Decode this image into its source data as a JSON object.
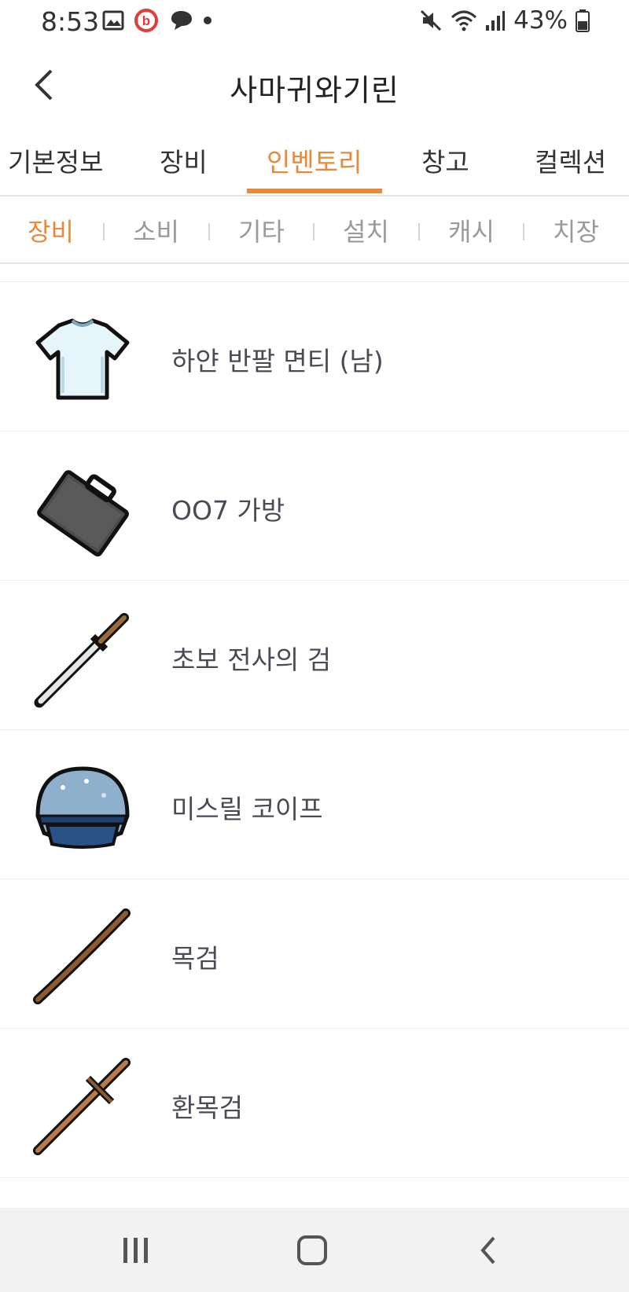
{
  "status_bar": {
    "time": "8:53",
    "battery": "43%",
    "left_icons": [
      "image-icon",
      "beats-icon",
      "chat-bubble-icon",
      "dot-icon"
    ],
    "right_icons": [
      "mute-icon",
      "wifi-icon",
      "signal-icon",
      "battery-icon"
    ]
  },
  "header": {
    "title": "사마귀와기린",
    "back_icon": "chevron-left-icon"
  },
  "main_tabs": [
    {
      "label": "기본정보",
      "active": false
    },
    {
      "label": "장비",
      "active": false
    },
    {
      "label": "인벤토리",
      "active": true
    },
    {
      "label": "창고",
      "active": false
    },
    {
      "label": "컬렉션",
      "active": false
    }
  ],
  "sub_tabs": [
    {
      "label": "장비",
      "active": true
    },
    {
      "label": "소비",
      "active": false
    },
    {
      "label": "기타",
      "active": false
    },
    {
      "label": "설치",
      "active": false
    },
    {
      "label": "캐시",
      "active": false
    },
    {
      "label": "치장",
      "active": false
    }
  ],
  "items": [
    {
      "name": "하얀 반팔 면티 (남)",
      "icon": "white-tshirt-icon"
    },
    {
      "name": "OO7 가방",
      "icon": "briefcase-icon"
    },
    {
      "name": "초보 전사의 검",
      "icon": "sword-icon"
    },
    {
      "name": "미스릴 코이프",
      "icon": "helmet-icon"
    },
    {
      "name": "목검",
      "icon": "wooden-sword-icon"
    },
    {
      "name": "환목검",
      "icon": "ring-wooden-sword-icon"
    }
  ],
  "nav_bar": {
    "buttons": [
      "recent-apps-icon",
      "home-icon",
      "back-icon"
    ]
  },
  "colors": {
    "accent": "#e8893a",
    "inactive_text": "#9a9a9a",
    "divider": "#e4e4e4",
    "nav_bg": "#f2f2f2"
  }
}
